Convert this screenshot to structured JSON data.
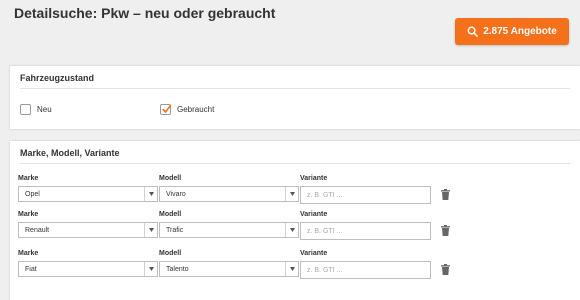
{
  "header": {
    "title": "Detailsuche: Pkw – neu oder gebraucht",
    "results_button_label": "2.875 Angebote"
  },
  "condition": {
    "title": "Fahrzeugzustand",
    "options": [
      {
        "label": "Neu",
        "checked": false
      },
      {
        "label": "Gebraucht",
        "checked": true
      }
    ]
  },
  "models": {
    "title": "Marke, Modell, Variante",
    "labels": {
      "make": "Marke",
      "model": "Modell",
      "variant": "Variante"
    },
    "variant_placeholder": "z. B. GTI ...",
    "rows": [
      {
        "make": "Opel",
        "model": "Vivaro"
      },
      {
        "make": "Renault",
        "model": "Trafic"
      },
      {
        "make": "Fiat",
        "model": "Talento"
      }
    ]
  },
  "colors": {
    "accent": "#f5701b",
    "background": "#efefef"
  },
  "icons": {
    "search": "search-icon",
    "checkmark": "checkmark-icon",
    "dropdown": "chevron-down-icon",
    "delete": "trash-icon"
  }
}
